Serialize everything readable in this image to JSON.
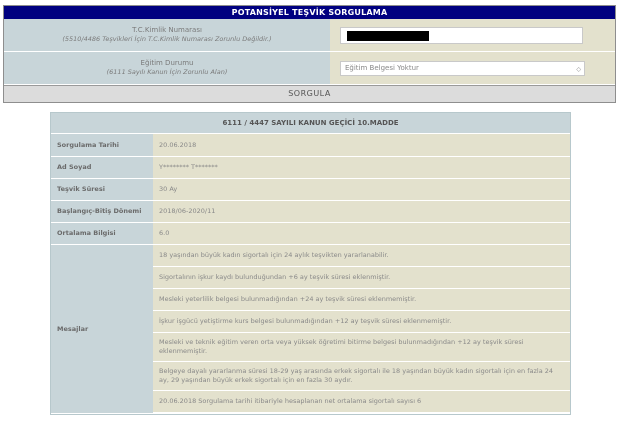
{
  "panel": {
    "title": "POTANSİYEL TEŞVİK SORGULAMA",
    "tc": {
      "label": "T.C.Kimlik Numarası",
      "note": "(5510/4486 Teşvikleri İçin T.C.Kimlik Numarası Zorunlu Değildir.)"
    },
    "education": {
      "label": "Eğitim Durumu",
      "note": "(6111 Sayılı Kanun İçin Zorunlu Alan)",
      "selected": "Eğitim Belgesi Yoktur"
    },
    "submit_label": "SORGULA"
  },
  "results": {
    "header": "6111 / 4447 SAYILI KANUN GEÇİCİ 10.MADDE",
    "rows": [
      {
        "label": "Sorgulama Tarihi",
        "value": "20.06.2018"
      },
      {
        "label": "Ad Soyad",
        "value": "Y******** T*******"
      },
      {
        "label": "Teşvik Süresi",
        "value": "30 Ay"
      },
      {
        "label": "Başlangıç-Bitiş Dönemi",
        "value": "2018/06-2020/11"
      },
      {
        "label": "Ortalama Bilgisi",
        "value": "6.0"
      }
    ],
    "messages_label": "Mesajlar",
    "messages": [
      "18 yaşından büyük kadın sigortalı için 24 aylık teşvikten yararlanabilir.",
      "Sigortalının işkur kaydı bulunduğundan +6 ay teşvik süresi eklenmiştir.",
      "Mesleki yeterlilik belgesi bulunmadığından +24 ay teşvik süresi eklenmemiştir.",
      "İşkur işgücü yetiştirme kurs belgesi bulunmadığından +12 ay teşvik süresi eklenmemiştir.",
      "Mesleki ve teknik eğitim veren orta veya yüksek öğretimi bitirme belgesi bulunmadığından +12 ay teşvik süresi eklenmemiştir.",
      "Belgeye dayalı yararlanma süresi 18-29 yaş arasında erkek sigortalı ile 18 yaşından büyük kadın sigortalı için en fazla 24 ay, 29 yaşından büyük erkek sigortalı için en fazla 30 aydır.",
      "20.06.2018 Sorgulama tarihi itibariyle hesaplanan net ortalama sigortalı sayısı 6"
    ]
  }
}
